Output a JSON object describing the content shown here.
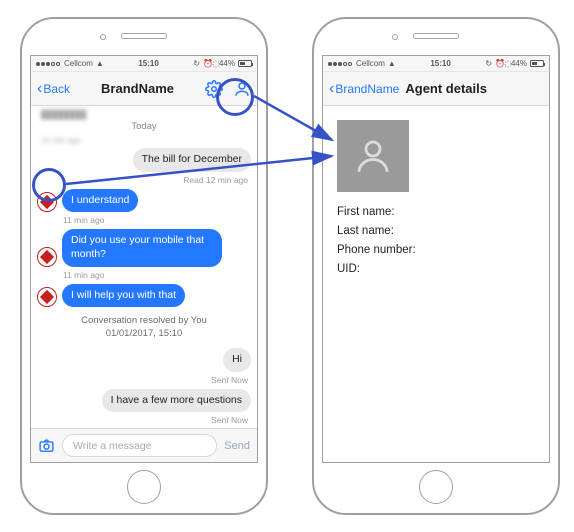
{
  "status": {
    "carrier": "Cellcom",
    "time": "15:10",
    "battery_pct": "44%"
  },
  "chat": {
    "back_label": "Back",
    "title": "BrandName",
    "day_label": "Today",
    "ghost_line1": "",
    "ghost_line2": "10 min ago",
    "msg_in_1": "The bill for December",
    "meta_in_1": "Read 12 min ago",
    "msg_out_1": "I understand",
    "meta_out_1": "11 min ago",
    "msg_out_2": "Did you use your mobile that month?",
    "meta_out_2": "11 min ago",
    "msg_out_3": "I will help you with that",
    "resolved_line1": "Conversation resolved by You",
    "resolved_line2": "01/01/2017, 15:10",
    "msg_in_2": "Hi",
    "meta_in_2": "Sent Now",
    "msg_in_3": "I have a few more questions",
    "meta_in_3": "Sent Now",
    "input_placeholder": "Write a message",
    "send_label": "Send"
  },
  "details": {
    "back_label": "BrandName",
    "title": "Agent details",
    "field_first": "First name:",
    "field_last": "Last name:",
    "field_phone": "Phone number:",
    "field_uid": "UID:"
  }
}
